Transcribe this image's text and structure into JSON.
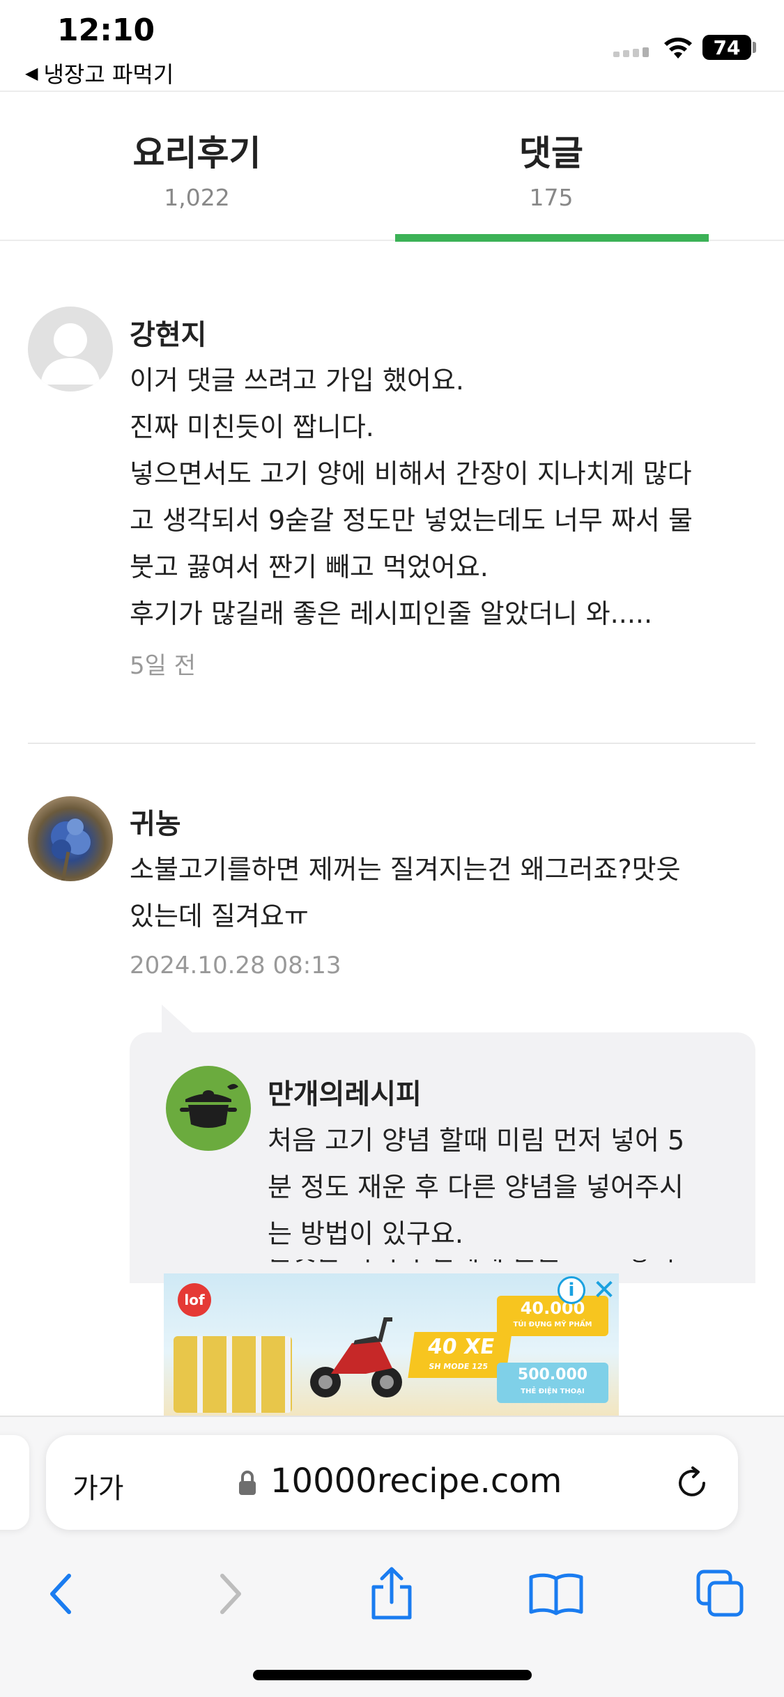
{
  "status_bar": {
    "time": "12:10",
    "back_app": "냉장고 파먹기",
    "battery": "74"
  },
  "tabs": [
    {
      "label": "요리후기",
      "count": "1,022",
      "selected": false
    },
    {
      "label": "댓글",
      "count": "175",
      "selected": true
    }
  ],
  "comments": [
    {
      "author": "강현지",
      "lines": [
        "이거 댓글 쓰려고 가입 했어요.",
        "진짜 미친듯이 짭니다.",
        "넣으면서도 고기 양에 비해서 간장이 지나치게 많다",
        "고 생각되서 9숟갈 정도만 넣었는데도 너무 짜서 물",
        "붓고 끓여서 짠기 빼고 먹었어요.",
        "후기가 많길래 좋은 레시피인줄 알았더니 와....."
      ],
      "time": "5일 전"
    },
    {
      "author": "귀농",
      "lines": [
        "소불고기를하면 제꺼는 질겨지는건 왜그러죠?맛읏",
        "있는데 질겨요ㅠ"
      ],
      "time": "2024.10.28 08:13",
      "reply": {
        "author": "만개의레시피",
        "lines": [
          "처음 고기 양념 할때 미림 먼저 넣어 5",
          "분 정도 재운 후 다른 양념을 넣어주시",
          "는 방법이 있구요."
        ],
        "cut_line": "물엿은 마지막 단계에 불을 끄고 넣어"
      }
    }
  ],
  "ad": {
    "logo": "lof",
    "badge_main": "40 XE",
    "badge_sub": "SH MODE 125",
    "prize_1": "40.000",
    "prize_1_sub": "TÚI ĐỰNG MỸ PHẨM",
    "prize_2": "500.000",
    "prize_2_sub": "THẺ ĐIỆN THOẠI",
    "info_icon": "i",
    "close_icon": "✕"
  },
  "browser": {
    "text_size_label": "가가",
    "url": "10000recipe.com"
  },
  "colors": {
    "accent_green": "#3cb257",
    "link_blue": "#1a7cf0",
    "ad_blue": "#1aa1e0"
  }
}
